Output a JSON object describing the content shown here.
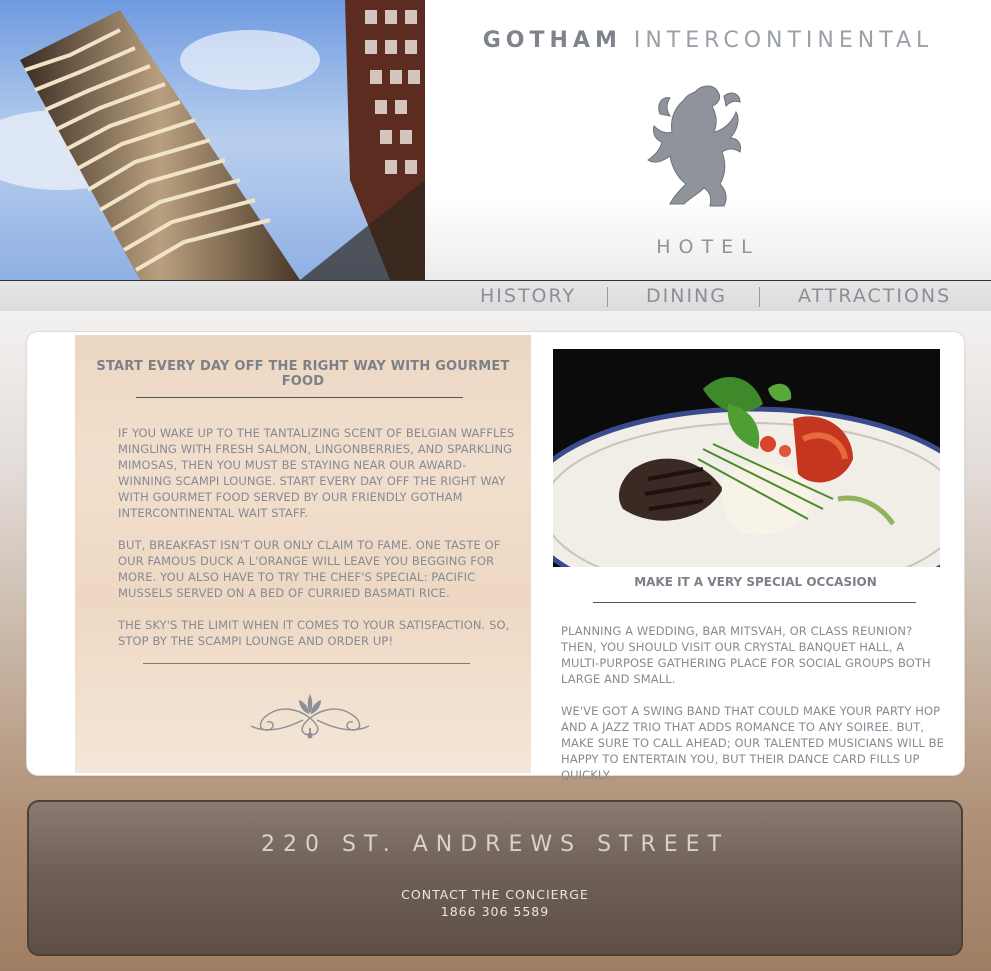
{
  "brand": {
    "name_strong": "GOTHAM",
    "name_light": "INTERCONTINENTAL",
    "subtitle": "HOTEL",
    "logo_icon": "lion-rampant-icon"
  },
  "nav": {
    "items": [
      {
        "label": "HISTORY"
      },
      {
        "label": "DINING"
      },
      {
        "label": "ATTRACTIONS"
      }
    ]
  },
  "dining": {
    "title": "START EVERY DAY OFF THE RIGHT WAY WITH GOURMET FOOD",
    "paragraphs": [
      "IF YOU WAKE UP TO THE TANTALIZING SCENT OF BELGIAN WAFFLES MINGLING WITH FRESH SALMON, LINGONBERRIES, AND SPARKLING MIMOSAS, THEN YOU MUST BE STAYING NEAR OUR AWARD-WINNING SCAMPI LOUNGE. START EVERY DAY OFF THE RIGHT WAY WITH GOURMET FOOD SERVED BY OUR FRIENDLY GOTHAM INTERCONTINENTAL WAIT STAFF.",
      "BUT, BREAKFAST ISN'T OUR ONLY CLAIM TO FAME. ONE TASTE OF OUR FAMOUS DUCK A L'ORANGE WILL LEAVE YOU BEGGING FOR MORE. YOU ALSO HAVE TO TRY THE CHEF'S SPECIAL: PACIFIC MUSSELS SERVED ON A BED OF CURRIED BASMATI RICE.",
      "THE SKY'S THE LIMIT WHEN IT COMES TO YOUR SATISFACTION. SO, STOP BY THE SCAMPI LOUNGE AND ORDER UP!"
    ]
  },
  "occasion": {
    "title": "MAKE IT A VERY SPECIAL OCCASION",
    "paragraphs": [
      "PLANNING A WEDDING, BAR MITSVAH, OR CLASS REUNION? THEN, YOU SHOULD VISIT OUR CRYSTAL BANQUET HALL, A MULTI-PURPOSE GATHERING PLACE FOR SOCIAL GROUPS BOTH LARGE AND SMALL.",
      "WE'VE GOT A SWING BAND THAT COULD MAKE YOUR PARTY HOP AND A JAZZ TRIO THAT ADDS ROMANCE TO ANY SOIREE. BUT, MAKE SURE TO CALL AHEAD; OUR TALENTED MUSICIANS WILL BE HAPPY TO ENTERTAIN YOU, BUT THEIR DANCE CARD FILLS UP QUICKLY."
    ]
  },
  "footer": {
    "address": "220 ST. ANDREWS STREET",
    "contact_label": "CONTACT THE CONCIERGE",
    "phone": "1866 306 5589"
  },
  "colors": {
    "text_gray": "#858a93",
    "panel_beige": "#eed8c3",
    "footer_brown": "#6f6158"
  }
}
